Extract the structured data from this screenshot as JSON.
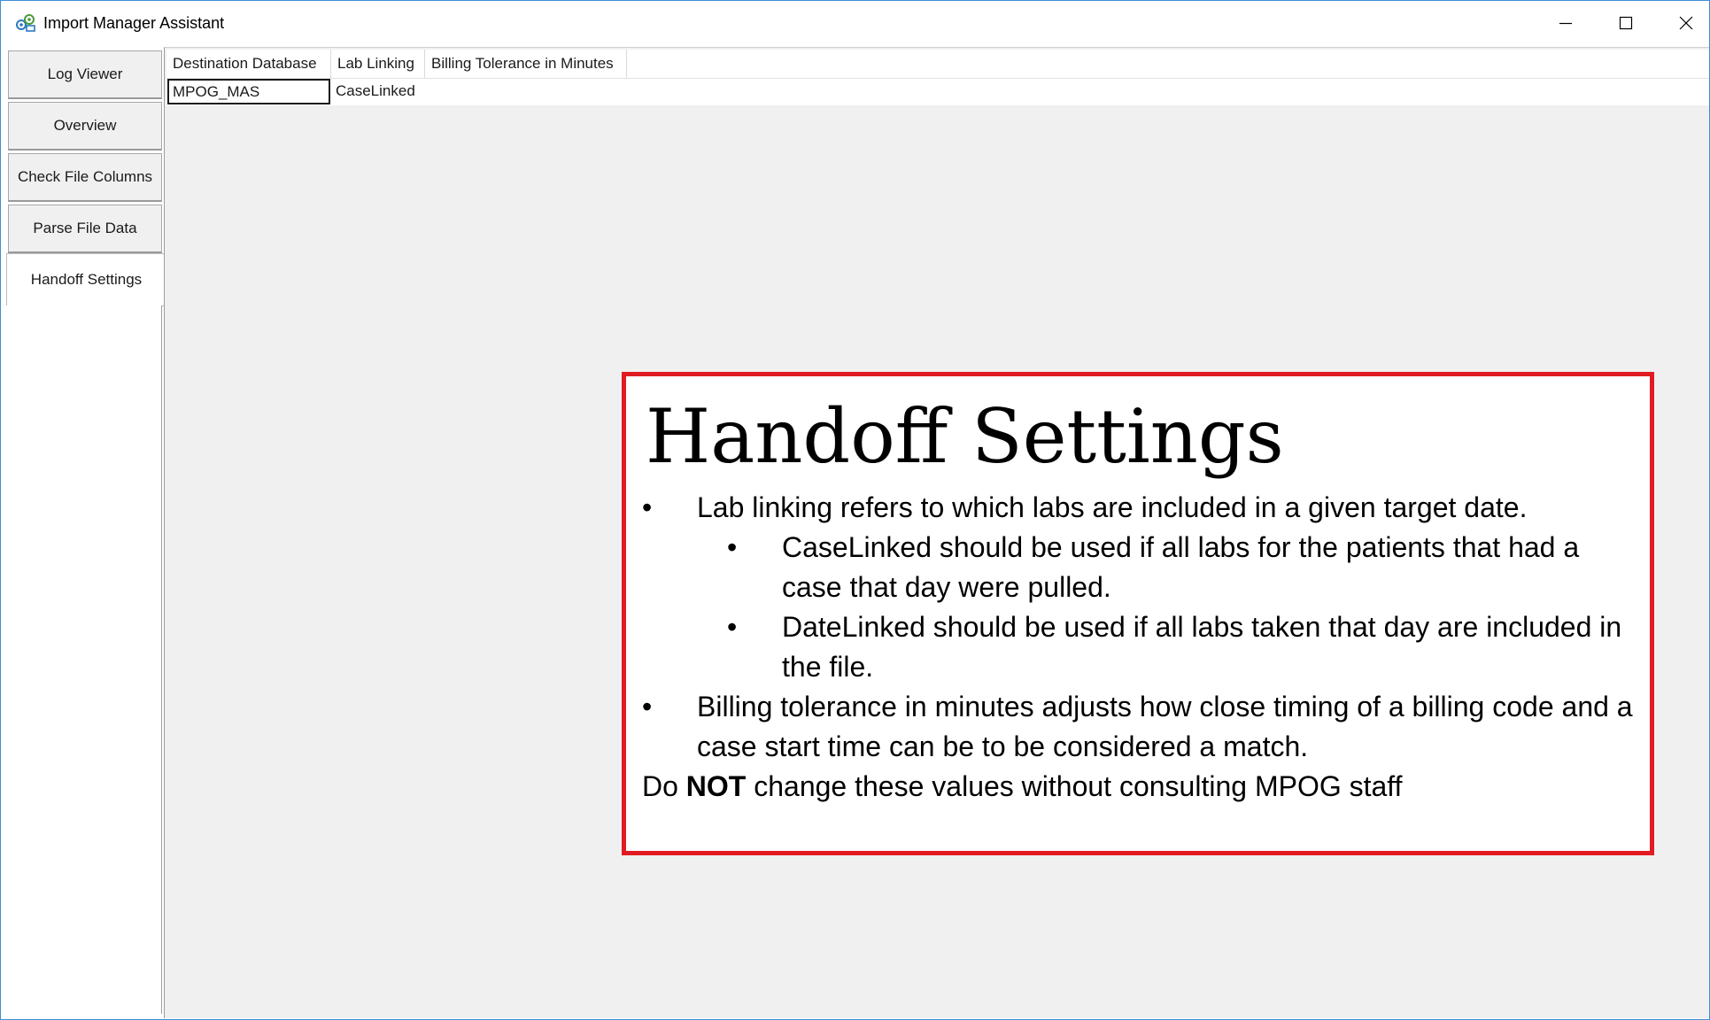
{
  "window": {
    "title": "Import Manager Assistant",
    "controls": {
      "minimize": "—",
      "maximize": "☐",
      "close": "✕"
    }
  },
  "tabs": [
    {
      "label": "Log Viewer",
      "selected": false
    },
    {
      "label": "Overview",
      "selected": false
    },
    {
      "label": "Check File Columns",
      "selected": false
    },
    {
      "label": "Parse File Data",
      "selected": false
    },
    {
      "label": "Handoff Settings",
      "selected": true
    }
  ],
  "grid": {
    "columns": [
      "Destination Database",
      "Lab Linking",
      "Billing Tolerance in Minutes"
    ],
    "rows": [
      {
        "destination_database": "MPOG_MAS",
        "lab_linking": "CaseLinked",
        "billing_tolerance": ""
      }
    ]
  },
  "callout": {
    "title": "Handoff Settings",
    "bullets": [
      {
        "bullet": "•",
        "text": "Lab linking refers to which labs are included in a given target date."
      },
      {
        "bullet": "•",
        "text": "CaseLinked should be used if all labs for the patients that had a case that day were pulled.",
        "sub": true
      },
      {
        "bullet": "•",
        "text": "DateLinked should be used if all labs taken that day are included in the file.",
        "sub": true
      },
      {
        "bullet": "•",
        "text": "Billing tolerance in minutes adjusts how close timing of a billing code and a case start time can be to be considered a match."
      }
    ],
    "note_prefix": "Do ",
    "note_emphasis": "NOT",
    "note_suffix": " change these values without consulting MPOG staff"
  },
  "colors": {
    "callout_border": "#e11b22",
    "window_border": "#3c8fd6",
    "content_background": "#f0f0f0"
  }
}
